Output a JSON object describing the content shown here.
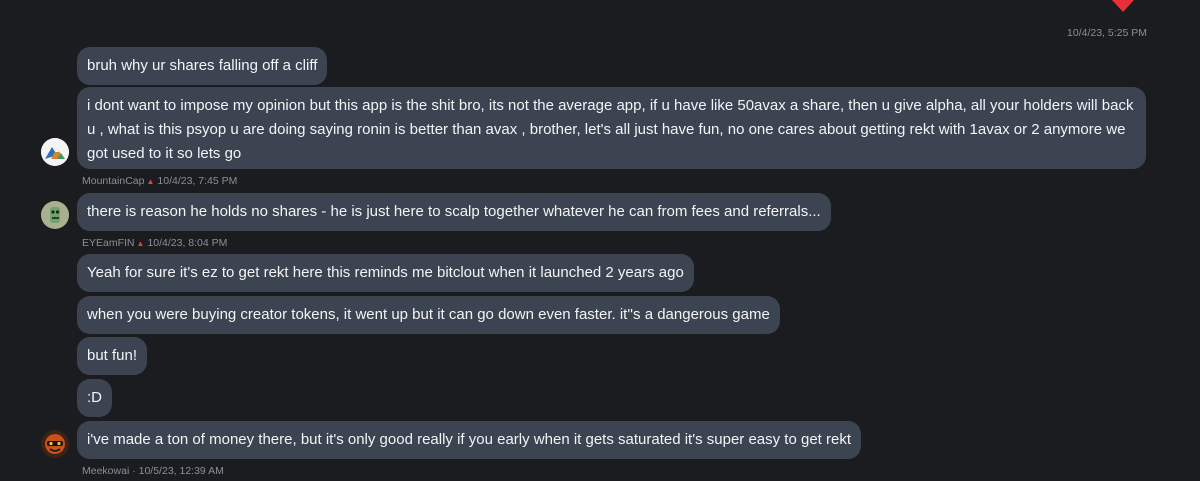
{
  "top": {
    "timestamp": "10/4/23, 5:25 PM"
  },
  "colors": {
    "background": "#1b1c1f",
    "bubble": "#3b4450",
    "meta_text": "#8b8f97",
    "heart": "#e8303a",
    "badge": "#e0453a"
  },
  "groups": [
    {
      "author": "MountainCap",
      "timestamp": "10/4/23, 7:45 PM",
      "avatar_icon": "mountain-avatar-icon",
      "messages": [
        "bruh why ur shares falling off a cliff",
        "i dont want to impose my opinion but this app is the shit bro, its not the average app, if u have like 50avax a share, then u give alpha, all your holders will back u , what is this psyop u are doing saying ronin is better than avax , brother, let's all just have fun, no one cares about getting rekt with 1avax or 2 anymore we got used to it so lets go"
      ]
    },
    {
      "author": "EYEamFIN",
      "timestamp": "10/4/23, 8:04 PM",
      "avatar_icon": "robot-avatar-icon",
      "messages": [
        "there is reason he holds no shares - he is just here to scalp together whatever he can from fees and referrals..."
      ]
    },
    {
      "author": "Meekowai",
      "timestamp": "10/5/23, 12:39 AM",
      "avatar_icon": "masked-avatar-icon",
      "messages": [
        "Yeah for sure it's ez to get rekt here this reminds me bitclout when it launched 2 years ago",
        "when you were buying creator tokens, it went up but it can go down even faster. it''s a dangerous game",
        "but fun!",
        ":D",
        "i've made a ton of money there, but it's only good really if you early when it gets saturated it's super easy to get rekt"
      ]
    }
  ]
}
